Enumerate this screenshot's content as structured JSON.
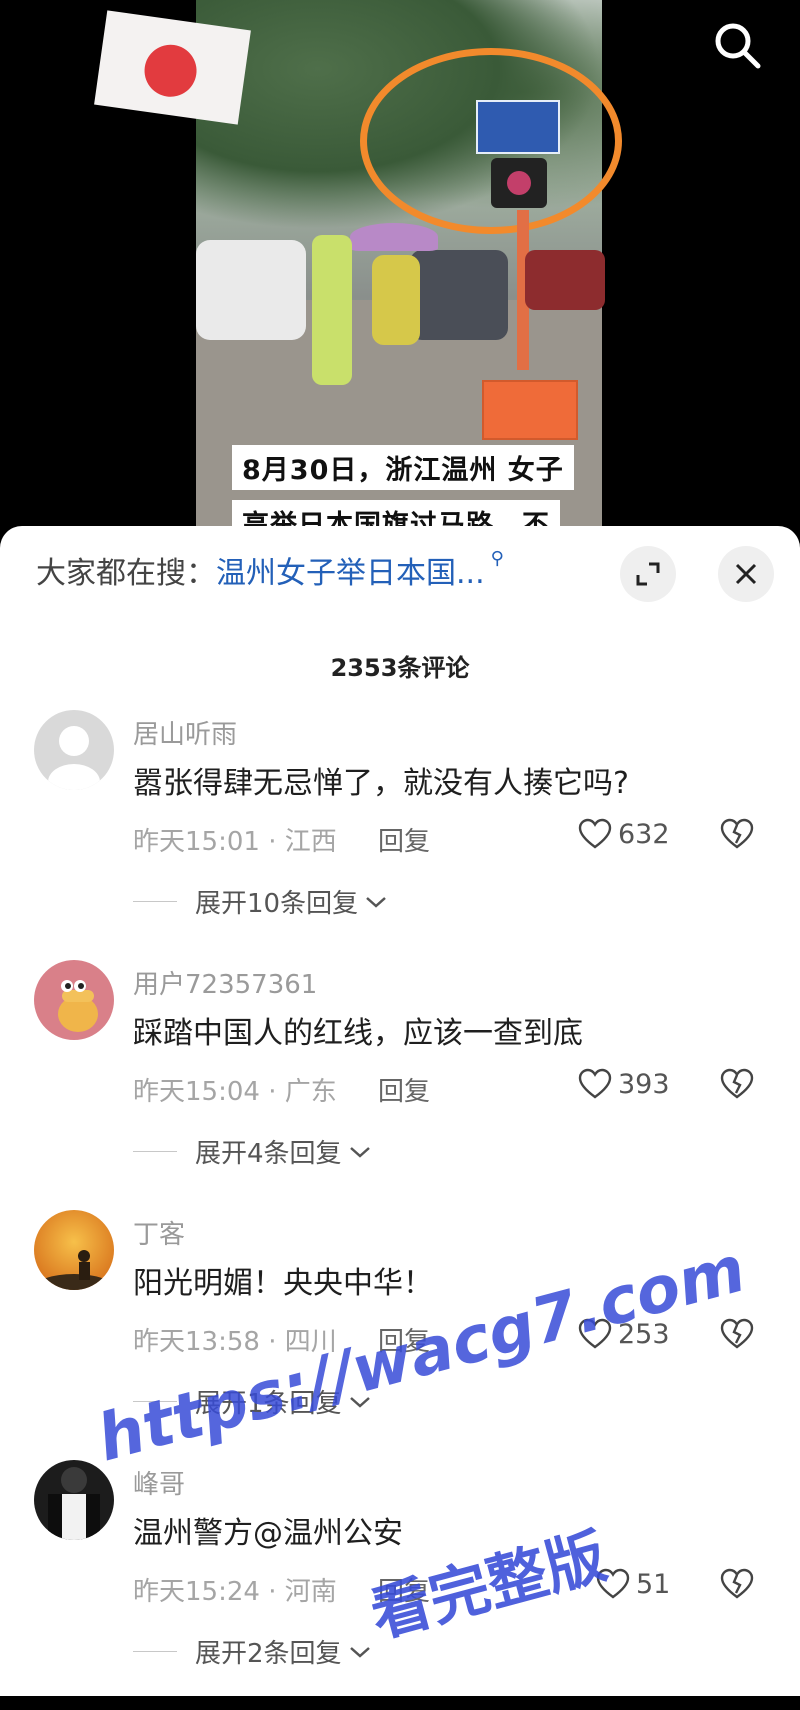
{
  "video": {
    "caption_line1": "8月30日，浙江温州 女子",
    "caption_line2": "高举日本国旗过马路，不"
  },
  "search_bar": {
    "prefix": "大家都在搜：",
    "keyword": "温州女子举日本国...",
    "keyword_icon": "search-icon"
  },
  "comment_count": "2353条评论",
  "comments": [
    {
      "username": "居山听雨",
      "text": "嚣张得肆无忌惮了，就没有人揍它吗?",
      "meta": "昨天15:01 · 江西",
      "reply_label": "回复",
      "likes": "632",
      "expand_label": "展开10条回复"
    },
    {
      "username": "用户72357361",
      "text": "踩踏中国人的红线，应该一查到底",
      "meta": "昨天15:04 · 广东",
      "reply_label": "回复",
      "likes": "393",
      "expand_label": "展开4条回复"
    },
    {
      "username": "丁客",
      "text": "阳光明媚！央央中华！",
      "meta": "昨天13:58 · 四川",
      "reply_label": "回复",
      "likes": "253",
      "expand_label": "展开1条回复"
    },
    {
      "username": "峰哥",
      "text": "温州警方@温州公安",
      "meta": "昨天15:24 · 河南",
      "reply_label": "回复",
      "likes": "51",
      "expand_label": "展开2条回复"
    }
  ],
  "watermark": {
    "url": "https://wacg7.com",
    "slogan": "看完整版"
  },
  "colors": {
    "link_blue": "#2360b8",
    "watermark_blue": "#3a4bd7"
  }
}
